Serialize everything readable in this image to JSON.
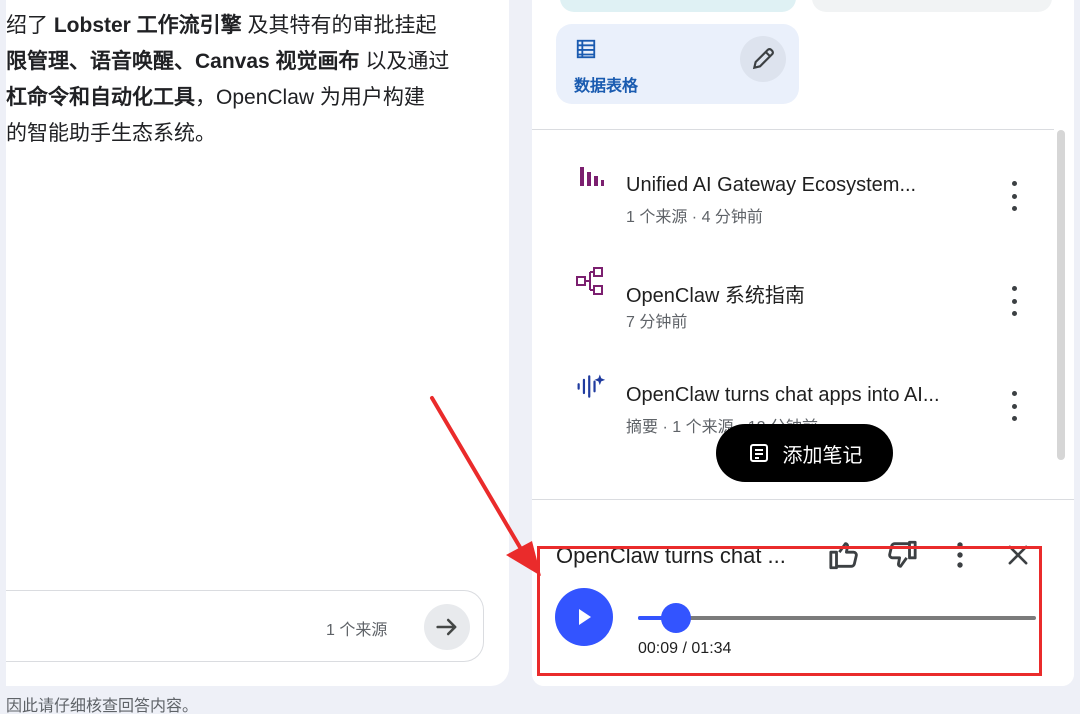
{
  "chat": {
    "lines": [
      {
        "parts": [
          {
            "text": "绍了 ",
            "bold": false
          },
          {
            "text": "Lobster 工作流引擎",
            "bold": true
          },
          {
            "text": " 及其特有的审批挂起",
            "bold": false
          }
        ]
      },
      {
        "parts": [
          {
            "text": "限管理、语音唤醒、Canvas 视觉画布",
            "bold": true
          },
          {
            "text": " 以及通过",
            "bold": false
          }
        ]
      },
      {
        "parts": [
          {
            "text": "杠命令和自动化工具",
            "bold": true
          },
          {
            "text": "，OpenClaw 为用户构建",
            "bold": false
          }
        ]
      },
      {
        "parts": [
          {
            "text": "的智能助手生态系统。",
            "bold": false
          }
        ]
      }
    ],
    "input_source_count": "1 个来源",
    "footer_text": "因此请仔细核查回答内容。"
  },
  "studio": {
    "table_card": {
      "label": "数据表格",
      "icon": "table-icon",
      "edit_icon": "pencil-icon"
    },
    "notes": [
      {
        "title": "Unified AI Gateway Ecosystem...",
        "subtitle": "1 个来源 · 4 分钟前",
        "icon": "bar-chart-icon",
        "color": "#7b1f6f"
      },
      {
        "title": "OpenClaw 系统指南",
        "subtitle": "7 分钟前",
        "icon": "mindmap-icon",
        "color": "#7b1f6f"
      },
      {
        "title": "OpenClaw turns chat apps into AI...",
        "subtitle": "摘要 · 1 个来源 · 12 分钟前",
        "icon": "audio-sparkle-icon",
        "color": "#203b9f"
      }
    ],
    "add_note_label": "添加笔记"
  },
  "player": {
    "title": "OpenClaw turns chat ...",
    "current_time": "00:09",
    "total_time": "01:34",
    "time_separator": " / ",
    "progress_fraction": 0.096,
    "accent_color": "#3354ff"
  },
  "annotation": {
    "color": "#ea2b2b"
  }
}
